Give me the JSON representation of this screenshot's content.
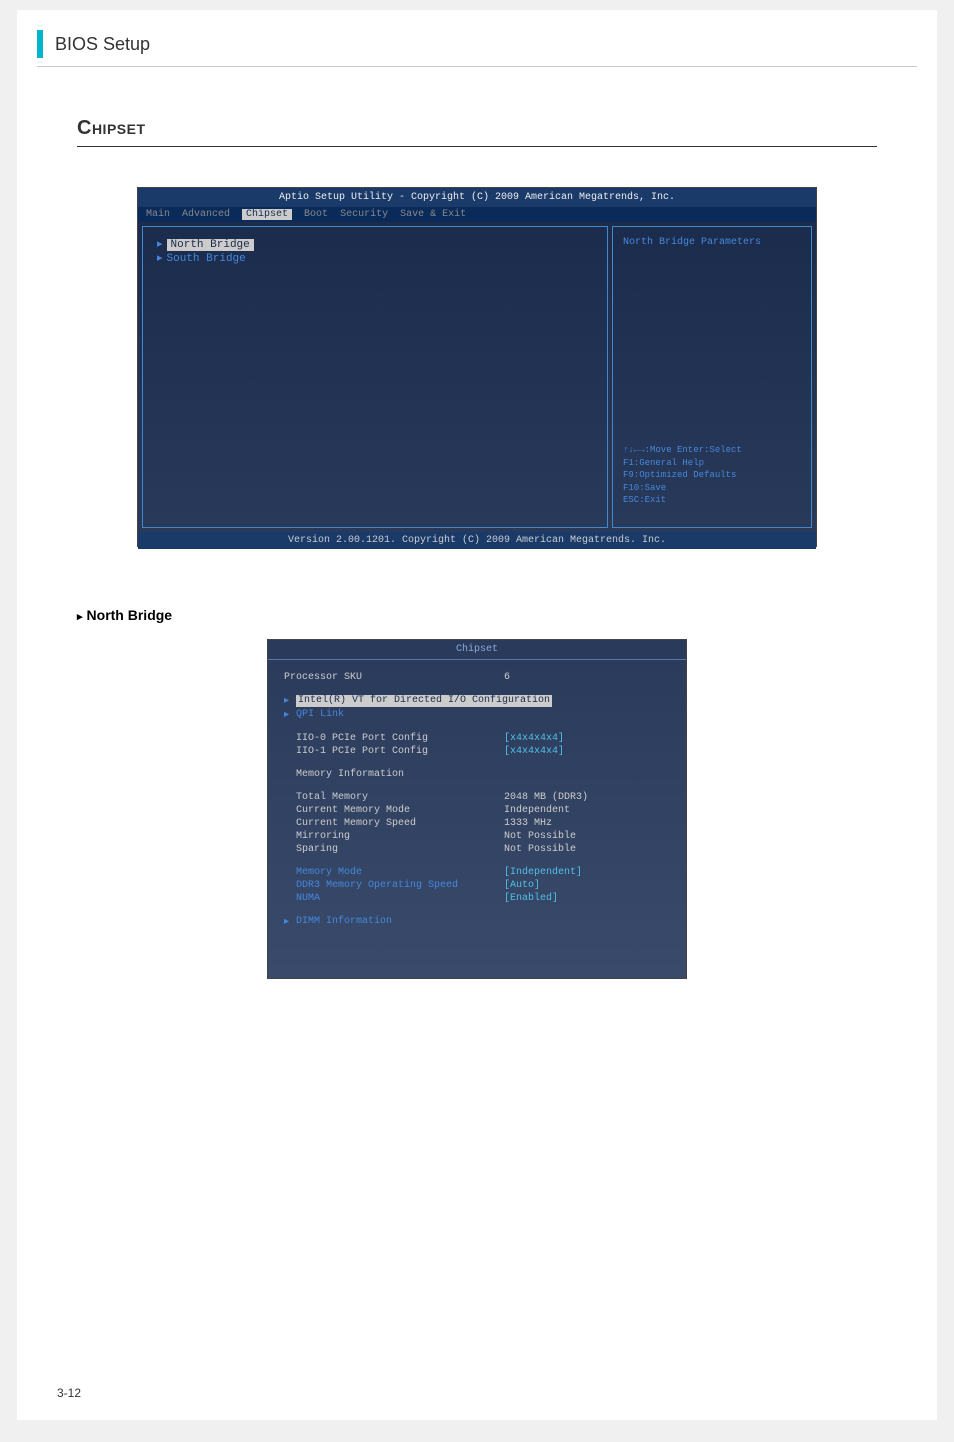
{
  "header": {
    "title": "BIOS Setup"
  },
  "section": {
    "title": "Chipset"
  },
  "bios1": {
    "topbar": "Aptio Setup Utility - Copyright (C) 2009 American Megatrends, Inc.",
    "tabs": [
      "Main",
      "Advanced",
      "Chipset",
      "Boot",
      "Security",
      "Save & Exit"
    ],
    "items": {
      "selected": "North Bridge",
      "other": "South Bridge"
    },
    "right_title": "North Bridge Parameters",
    "help": {
      "line1": "↑↓←→:Move  Enter:Select",
      "line2": "F1:General Help",
      "line3": "F9:Optimized Defaults",
      "line4": "F10:Save",
      "line5": "ESC:Exit"
    },
    "bottombar": "Version 2.00.1201. Copyright (C) 2009 American Megatrends. Inc."
  },
  "subsection": {
    "title": "North Bridge"
  },
  "bios2": {
    "header": "Chipset",
    "processor_sku_label": "Processor SKU",
    "processor_sku_value": "6",
    "vt_config": "Intel(R) VT for Directed I/O Configuration",
    "qpi_link": "QPI Link",
    "iio0_label": "IIO-0 PCIe Port Config",
    "iio0_value": "[x4x4x4x4]",
    "iio1_label": "IIO-1 PCIe Port Config",
    "iio1_value": "[x4x4x4x4]",
    "mem_info": "Memory Information",
    "total_mem_label": "Total Memory",
    "total_mem_value": "2048 MB (DDR3)",
    "cur_mode_label": "Current Memory Mode",
    "cur_mode_value": "Independent",
    "cur_speed_label": "Current Memory Speed",
    "cur_speed_value": "1333 MHz",
    "mirroring_label": "Mirroring",
    "mirroring_value": "Not Possible",
    "sparing_label": "Sparing",
    "sparing_value": "Not Possible",
    "mem_mode_label": "Memory Mode",
    "mem_mode_value": "[Independent]",
    "ddr3_speed_label": "DDR3 Memory Operating Speed",
    "ddr3_speed_value": "[Auto]",
    "numa_label": "NUMA",
    "numa_value": "[Enabled]",
    "dimm_info": "DIMM Information"
  },
  "page_number": "3-12"
}
